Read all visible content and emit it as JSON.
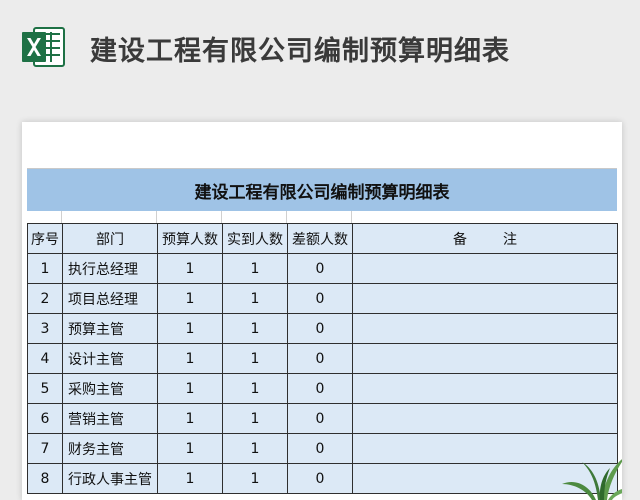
{
  "page": {
    "title": "建设工程有限公司编制预算明细表",
    "app_icon": "excel-icon",
    "colors": {
      "icon_green": "#1e7145",
      "band_blue": "#9fc3e6",
      "cell_blue": "#dce9f6"
    }
  },
  "sheet": {
    "band_title": "建设工程有限公司编制预算明细表",
    "columns": {
      "seq": "序号",
      "dept": "部门",
      "budget": "预算人数",
      "actual": "实到人数",
      "diff": "差额人数",
      "note_a": "备",
      "note_b": "注"
    },
    "rows": [
      {
        "seq": "1",
        "dept": "执行总经理",
        "budget": "1",
        "actual": "1",
        "diff": "0",
        "note": ""
      },
      {
        "seq": "2",
        "dept": "项目总经理",
        "budget": "1",
        "actual": "1",
        "diff": "0",
        "note": ""
      },
      {
        "seq": "3",
        "dept": "预算主管",
        "budget": "1",
        "actual": "1",
        "diff": "0",
        "note": ""
      },
      {
        "seq": "4",
        "dept": "设计主管",
        "budget": "1",
        "actual": "1",
        "diff": "0",
        "note": ""
      },
      {
        "seq": "5",
        "dept": "采购主管",
        "budget": "1",
        "actual": "1",
        "diff": "0",
        "note": ""
      },
      {
        "seq": "6",
        "dept": "营销主管",
        "budget": "1",
        "actual": "1",
        "diff": "0",
        "note": ""
      },
      {
        "seq": "7",
        "dept": "财务主管",
        "budget": "1",
        "actual": "1",
        "diff": "0",
        "note": ""
      },
      {
        "seq": "8",
        "dept": "行政人事主管",
        "budget": "1",
        "actual": "1",
        "diff": "0",
        "note": ""
      }
    ]
  }
}
